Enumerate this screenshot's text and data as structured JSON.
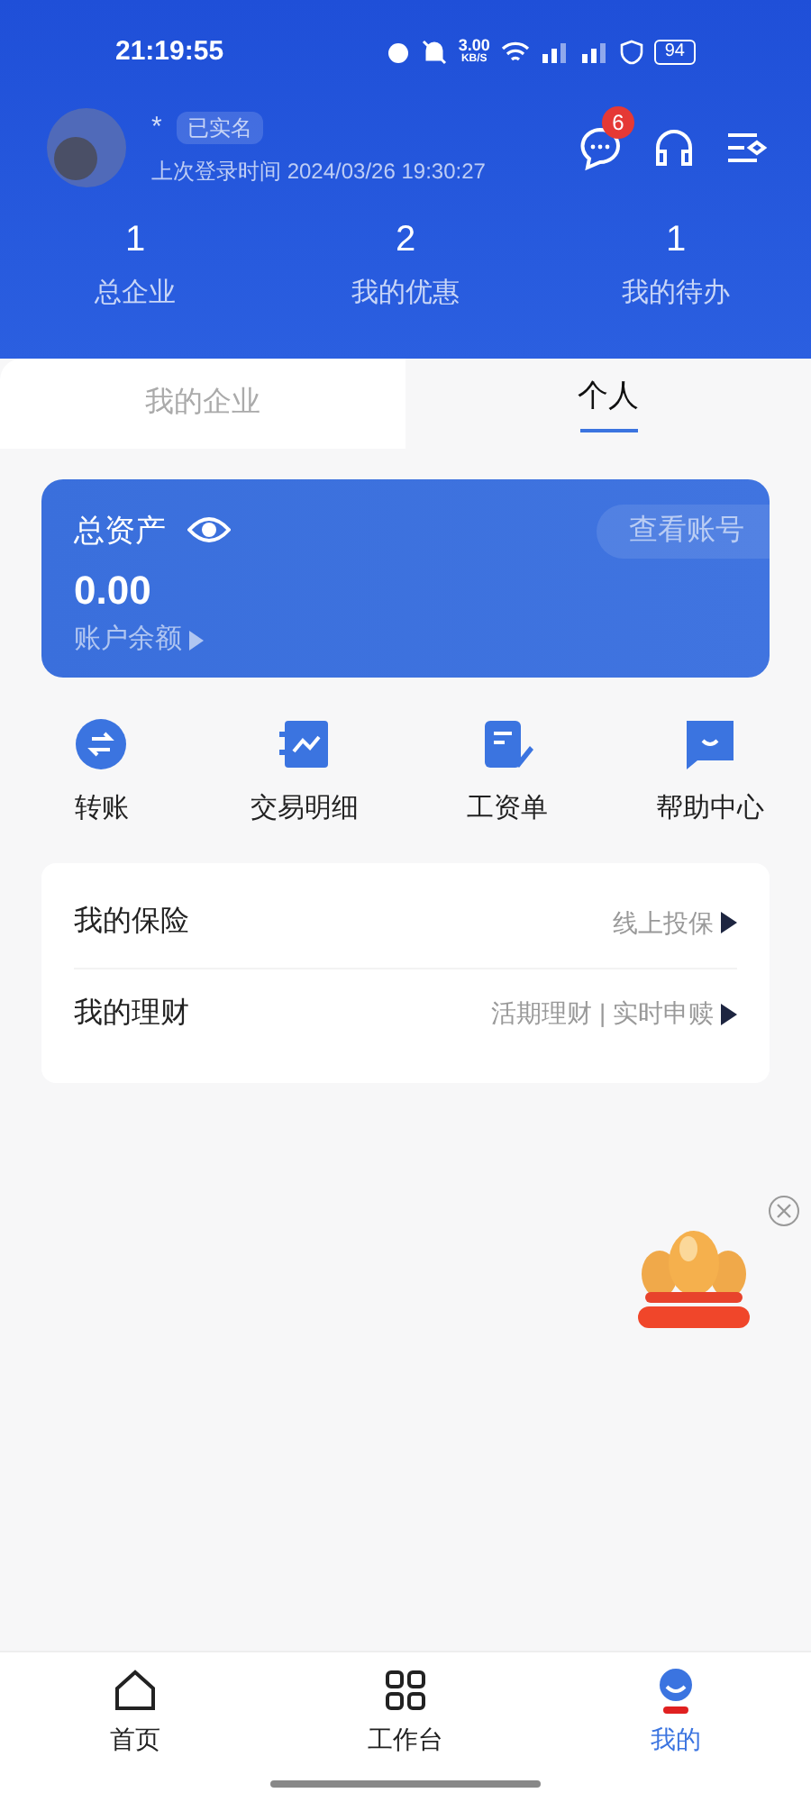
{
  "status_bar": {
    "time": "21:19:55",
    "speed": "3.00",
    "speed_unit": "KB/S",
    "battery": "94"
  },
  "profile": {
    "name": "*",
    "badge": "已实名",
    "last_login": "上次登录时间 2024/03/26 19:30:27",
    "message_count": "6"
  },
  "stats": [
    {
      "value": "1",
      "label": "总企业"
    },
    {
      "value": "2",
      "label": "我的优惠"
    },
    {
      "value": "1",
      "label": "我的待办"
    }
  ],
  "tabs": [
    {
      "label": "我的企业",
      "selected": false
    },
    {
      "label": "个人",
      "selected": true
    }
  ],
  "asset_card": {
    "title": "总资产",
    "amount": "0.00",
    "link": "账户余额",
    "button": "查看账号"
  },
  "shortcuts": [
    {
      "kind": "transfer",
      "label": "转账"
    },
    {
      "kind": "details",
      "label": "交易明细"
    },
    {
      "kind": "payslip",
      "label": "工资单"
    },
    {
      "kind": "help",
      "label": "帮助中心"
    }
  ],
  "menu": [
    {
      "title": "我的保险",
      "hint": "线上投保"
    },
    {
      "title": "我的理财",
      "hint": "活期理财 | 实时申赎"
    }
  ],
  "bottom_nav": [
    {
      "kind": "home",
      "label": "首页",
      "selected": false
    },
    {
      "kind": "workbench",
      "label": "工作台",
      "selected": false
    },
    {
      "kind": "me",
      "label": "我的",
      "selected": true
    }
  ]
}
